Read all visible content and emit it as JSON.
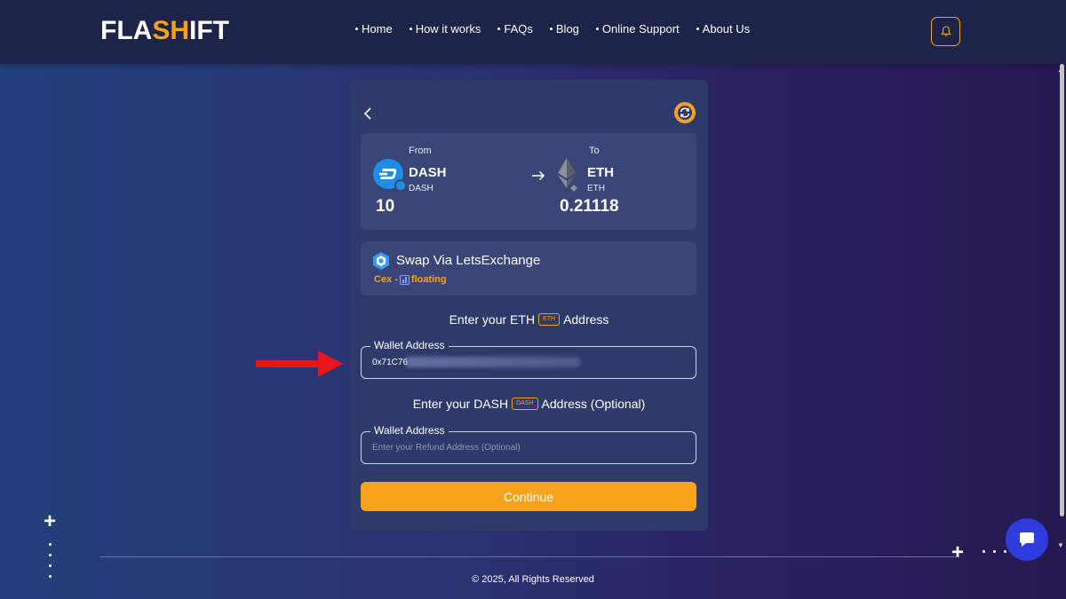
{
  "header": {
    "logo_left": "FLA",
    "logo_mid": "SH",
    "logo_right": "IFT",
    "nav": [
      {
        "label": "Home"
      },
      {
        "label": "How it works"
      },
      {
        "label": "FAQs"
      },
      {
        "label": "Blog"
      },
      {
        "label": "Online Support"
      },
      {
        "label": "About Us"
      }
    ],
    "bell_icon": "bell-icon"
  },
  "swap": {
    "from_label": "From",
    "to_label": "To",
    "from": {
      "symbol": "DASH",
      "network": "DASH",
      "amount": "10",
      "icon": "dash-icon"
    },
    "to": {
      "symbol": "ETH",
      "network": "ETH",
      "amount": "0.21118",
      "icon": "eth-icon"
    },
    "arrow_icon": "arrow-right-icon"
  },
  "via": {
    "title": "Swap Via LetsExchange",
    "type_label": "Cex -",
    "rate_label": "floating",
    "icon": "letsexchange-icon"
  },
  "eth_address": {
    "prefix": "Enter your ETH",
    "chip": "ETH",
    "suffix": "Address",
    "field_label": "Wallet Address",
    "value": "0x71C76"
  },
  "refund_address": {
    "prefix": "Enter your DASH",
    "chip": "DASH",
    "suffix": "Address (Optional)",
    "field_label": "Wallet Address",
    "placeholder": "Enter your Refund Address (Optional)"
  },
  "continue_label": "Continue",
  "footer": {
    "copyright": "© 2025, All Rights Reserved"
  },
  "colors": {
    "accent": "#f7a21b",
    "card": "#2e3a6a",
    "panel": "#3a4678",
    "chat": "#2f3cdc",
    "annotation_arrow": "#e8151b"
  }
}
